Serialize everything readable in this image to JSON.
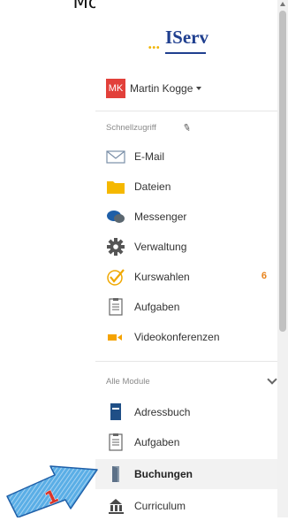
{
  "top_text": "Monaten intensi",
  "logo": {
    "text": "IServ",
    "dots": "•••"
  },
  "user": {
    "initials": "MK",
    "name": "Martin Kogge"
  },
  "quick_access": {
    "label": "Schnellzugriff",
    "items": [
      {
        "label": "E-Mail",
        "icon": "envelope-icon"
      },
      {
        "label": "Dateien",
        "icon": "folder-icon"
      },
      {
        "label": "Messenger",
        "icon": "chat-bubbles-icon"
      },
      {
        "label": "Verwaltung",
        "icon": "gear-icon"
      },
      {
        "label": "Kurswahlen",
        "icon": "checkmark-circle-icon",
        "badge": "6"
      },
      {
        "label": "Aufgaben",
        "icon": "clipboard-icon"
      },
      {
        "label": "Videokonferenzen",
        "icon": "video-camera-icon"
      }
    ]
  },
  "all_modules": {
    "label": "Alle Module",
    "items": [
      {
        "label": "Adressbuch",
        "icon": "address-book-icon"
      },
      {
        "label": "Aufgaben",
        "icon": "clipboard-icon"
      },
      {
        "label": "Buchungen",
        "icon": "door-icon",
        "active": true
      },
      {
        "label": "Curriculum",
        "icon": "curriculum-icon"
      }
    ]
  },
  "annotation": {
    "number": "1"
  },
  "colors": {
    "avatar_bg": "#e2403a",
    "logo_blue": "#1f3f8f",
    "logo_dots": "#f0b400",
    "badge": "#e8821a",
    "folder": "#f5b800",
    "video": "#f5a300",
    "annotation_arrow": "#4fa3df",
    "annotation_number": "#d9362b"
  }
}
